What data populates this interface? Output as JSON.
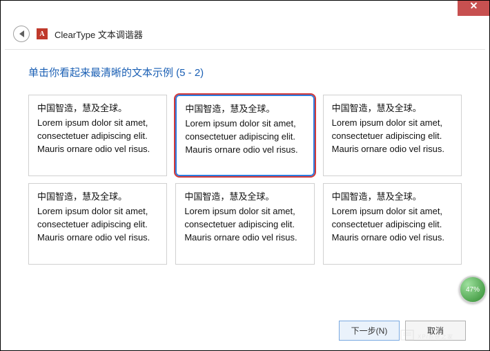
{
  "window": {
    "title": "ClearType 文本调谐器",
    "app_icon_letter": "A"
  },
  "instruction": {
    "text": "单击你看起来最清晰的文本示例 (5 - 2)"
  },
  "samples": [
    {
      "cn": "中国智造，慧及全球。",
      "latin": "Lorem ipsum dolor sit amet, consectetuer adipiscing elit. Mauris ornare odio vel risus.",
      "selected": false
    },
    {
      "cn": "中国智造，慧及全球。",
      "latin": "Lorem ipsum dolor sit amet, consectetuer adipiscing elit. Mauris ornare odio vel risus.",
      "selected": true
    },
    {
      "cn": "中国智造，慧及全球。",
      "latin": "Lorem ipsum dolor sit amet, consectetuer adipiscing elit. Mauris ornare odio vel risus.",
      "selected": false
    },
    {
      "cn": "中国智造，慧及全球。",
      "latin": "Lorem ipsum dolor sit amet, consectetuer adipiscing elit. Mauris ornare odio vel risus.",
      "selected": false
    },
    {
      "cn": "中国智造，慧及全球。",
      "latin": "Lorem ipsum dolor sit amet, consectetuer adipiscing elit. Mauris ornare odio vel risus.",
      "selected": false
    },
    {
      "cn": "中国智造，慧及全球。",
      "latin": "Lorem ipsum dolor sit amet, consectetuer adipiscing elit. Mauris ornare odio vel risus.",
      "selected": false
    }
  ],
  "buttons": {
    "next": "下一步(N)",
    "cancel": "取消"
  },
  "progress": {
    "percent": "47%"
  }
}
